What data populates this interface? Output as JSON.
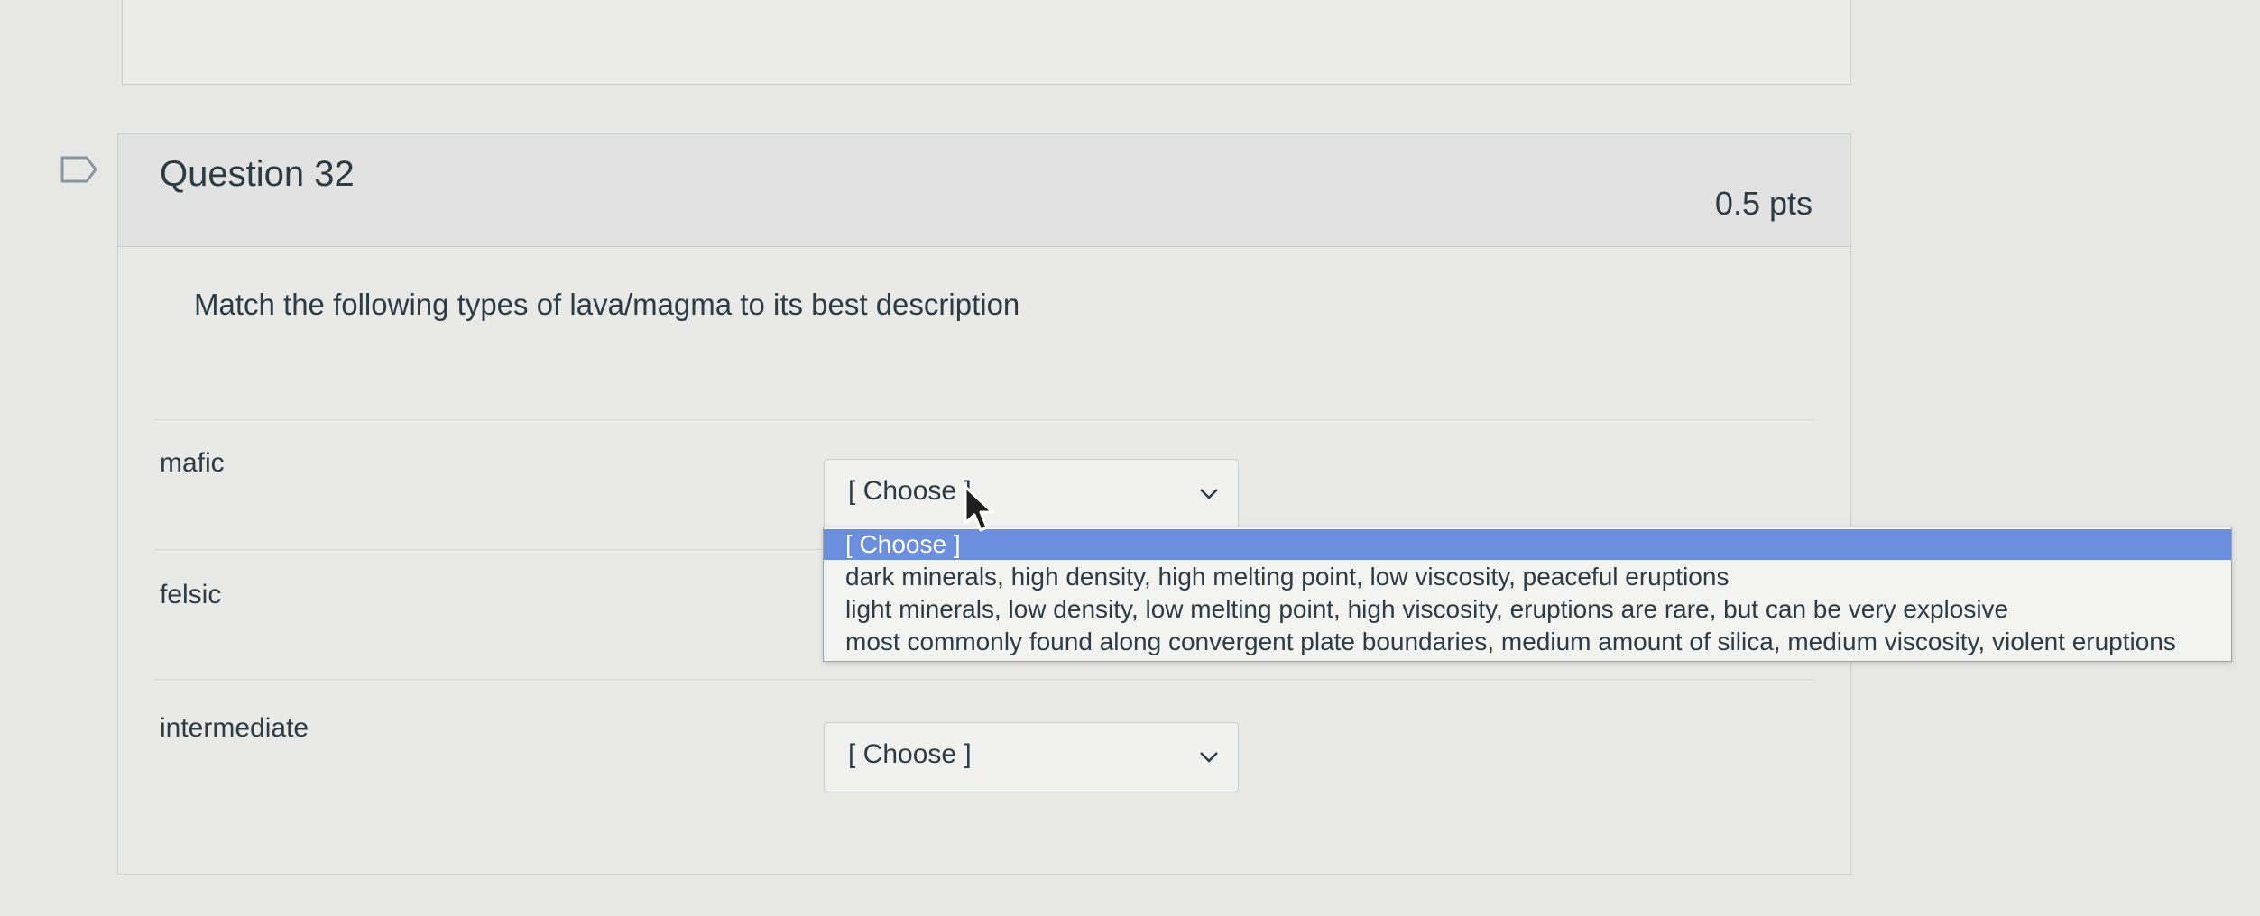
{
  "question": {
    "title": "Question 32",
    "points": "0.5 pts",
    "prompt": "Match the following types of lava/magma to its best description"
  },
  "rows": [
    {
      "label": "mafic",
      "selected": "[ Choose ]"
    },
    {
      "label": "felsic"
    },
    {
      "label": "intermediate",
      "selected": "[ Choose ]"
    }
  ],
  "dropdown": {
    "options": [
      "[ Choose ]",
      "dark minerals, high density, high melting point, low viscosity, peaceful eruptions",
      "light minerals, low density, low melting point, high viscosity, eruptions are rare, but can be very explosive",
      "most commonly found along convergent plate boundaries, medium amount of silica, medium viscosity, violent eruptions"
    ],
    "highlighted_index": 0
  },
  "colors": {
    "highlight": "#6b8fdc",
    "text": "#2d3b45",
    "border": "#c7cdd1"
  },
  "icons": [
    "bookmark-icon",
    "chevron-down-icon",
    "mouse-cursor-icon"
  ]
}
